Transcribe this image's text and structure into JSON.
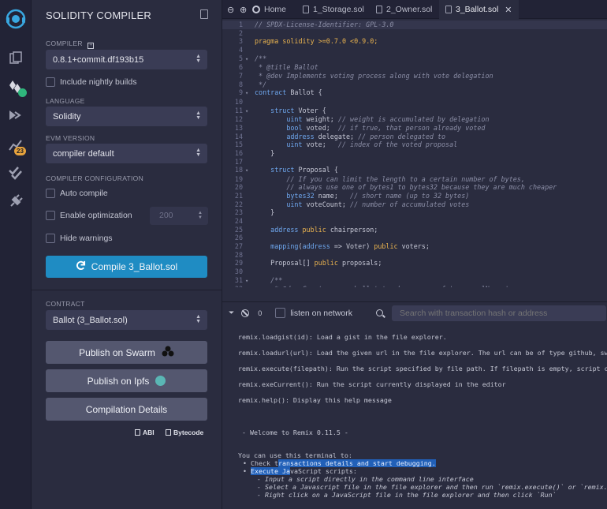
{
  "rail": {
    "icons": [
      "remix-logo-icon",
      "file-explorer-icon",
      "solidity-compiler-icon",
      "deploy-run-icon",
      "analysis-icon",
      "testing-icon",
      "plugin-manager-icon"
    ],
    "badge": "23"
  },
  "compiler": {
    "title": "SOLIDITY COMPILER",
    "compiler_label": "COMPILER",
    "compiler_version": "0.8.1+commit.df193b15",
    "include_nightly": "Include nightly builds",
    "language_label": "LANGUAGE",
    "language": "Solidity",
    "evm_label": "EVM VERSION",
    "evm": "compiler default",
    "config_label": "COMPILER CONFIGURATION",
    "auto_compile": "Auto compile",
    "enable_optimization": "Enable optimization",
    "runs": "200",
    "hide_warnings": "Hide warnings",
    "compile_button": "Compile 3_Ballot.sol",
    "contract_label": "CONTRACT",
    "contract": "Ballot (3_Ballot.sol)",
    "publish_swarm": "Publish on Swarm",
    "publish_ipfs": "Publish on Ipfs",
    "compilation_details": "Compilation Details",
    "abi": "ABI",
    "bytecode": "Bytecode",
    "accent": "#1f8cc3"
  },
  "tabs": {
    "home": "Home",
    "tab1": "1_Storage.sol",
    "tab2": "2_Owner.sol",
    "tab3": "3_Ballot.sol"
  },
  "editor": {
    "lines": [
      {
        "n": "1",
        "fold": "",
        "parts": [
          {
            "c": "cm",
            "t": "// SPDX-License-Identifier: GPL-3.0"
          }
        ]
      },
      {
        "n": "2",
        "fold": "",
        "parts": []
      },
      {
        "n": "3",
        "fold": "",
        "parts": [
          {
            "c": "pr",
            "t": "pragma solidity "
          },
          {
            "c": "pr",
            "t": ">=0.7.0 <0.9.0;"
          }
        ]
      },
      {
        "n": "4",
        "fold": "",
        "parts": []
      },
      {
        "n": "5",
        "fold": "▾",
        "parts": [
          {
            "c": "cm",
            "t": "/**"
          }
        ]
      },
      {
        "n": "6",
        "fold": "",
        "parts": [
          {
            "c": "cm",
            "t": " * @title Ballot"
          }
        ]
      },
      {
        "n": "7",
        "fold": "",
        "parts": [
          {
            "c": "cm",
            "t": " * @dev Implements voting process along with vote delegation"
          }
        ]
      },
      {
        "n": "8",
        "fold": "",
        "parts": [
          {
            "c": "cm",
            "t": " */"
          }
        ]
      },
      {
        "n": "9",
        "fold": "▾",
        "parts": [
          {
            "c": "kw",
            "t": "contract"
          },
          {
            "c": "tx",
            "t": " Ballot {"
          }
        ]
      },
      {
        "n": "10",
        "fold": "",
        "parts": []
      },
      {
        "n": "11",
        "fold": "▾",
        "parts": [
          {
            "c": "tx",
            "t": "    "
          },
          {
            "c": "kw",
            "t": "struct"
          },
          {
            "c": "tx",
            "t": " Voter {"
          }
        ]
      },
      {
        "n": "12",
        "fold": "",
        "parts": [
          {
            "c": "tx",
            "t": "        "
          },
          {
            "c": "kw",
            "t": "uint"
          },
          {
            "c": "tx",
            "t": " weight; "
          },
          {
            "c": "cm",
            "t": "// weight is accumulated by delegation"
          }
        ]
      },
      {
        "n": "13",
        "fold": "",
        "parts": [
          {
            "c": "tx",
            "t": "        "
          },
          {
            "c": "kw",
            "t": "bool"
          },
          {
            "c": "tx",
            "t": " voted;  "
          },
          {
            "c": "cm",
            "t": "// if true, that person already voted"
          }
        ]
      },
      {
        "n": "14",
        "fold": "",
        "parts": [
          {
            "c": "tx",
            "t": "        "
          },
          {
            "c": "kw",
            "t": "address"
          },
          {
            "c": "tx",
            "t": " delegate; "
          },
          {
            "c": "cm",
            "t": "// person delegated to"
          }
        ]
      },
      {
        "n": "15",
        "fold": "",
        "parts": [
          {
            "c": "tx",
            "t": "        "
          },
          {
            "c": "kw",
            "t": "uint"
          },
          {
            "c": "tx",
            "t": " vote;   "
          },
          {
            "c": "cm",
            "t": "// index of the voted proposal"
          }
        ]
      },
      {
        "n": "16",
        "fold": "",
        "parts": [
          {
            "c": "tx",
            "t": "    }"
          }
        ]
      },
      {
        "n": "17",
        "fold": "",
        "parts": []
      },
      {
        "n": "18",
        "fold": "▾",
        "parts": [
          {
            "c": "tx",
            "t": "    "
          },
          {
            "c": "kw",
            "t": "struct"
          },
          {
            "c": "tx",
            "t": " Proposal {"
          }
        ]
      },
      {
        "n": "19",
        "fold": "",
        "parts": [
          {
            "c": "cm",
            "t": "        // If you can limit the length to a certain number of bytes,"
          }
        ]
      },
      {
        "n": "20",
        "fold": "",
        "parts": [
          {
            "c": "cm",
            "t": "        // always use one of bytes1 to bytes32 because they are much cheaper"
          }
        ]
      },
      {
        "n": "21",
        "fold": "",
        "parts": [
          {
            "c": "tx",
            "t": "        "
          },
          {
            "c": "kw",
            "t": "bytes32"
          },
          {
            "c": "tx",
            "t": " name;   "
          },
          {
            "c": "cm",
            "t": "// short name (up to 32 bytes)"
          }
        ]
      },
      {
        "n": "22",
        "fold": "",
        "parts": [
          {
            "c": "tx",
            "t": "        "
          },
          {
            "c": "kw",
            "t": "uint"
          },
          {
            "c": "tx",
            "t": " voteCount; "
          },
          {
            "c": "cm",
            "t": "// number of accumulated votes"
          }
        ]
      },
      {
        "n": "23",
        "fold": "",
        "parts": [
          {
            "c": "tx",
            "t": "    }"
          }
        ]
      },
      {
        "n": "24",
        "fold": "",
        "parts": []
      },
      {
        "n": "25",
        "fold": "",
        "parts": [
          {
            "c": "tx",
            "t": "    "
          },
          {
            "c": "kw",
            "t": "address"
          },
          {
            "c": "tx",
            "t": " "
          },
          {
            "c": "pr",
            "t": "public"
          },
          {
            "c": "tx",
            "t": " chairperson;"
          }
        ]
      },
      {
        "n": "26",
        "fold": "",
        "parts": []
      },
      {
        "n": "27",
        "fold": "",
        "parts": [
          {
            "c": "tx",
            "t": "    "
          },
          {
            "c": "kw",
            "t": "mapping"
          },
          {
            "c": "tx",
            "t": "("
          },
          {
            "c": "kw",
            "t": "address"
          },
          {
            "c": "tx",
            "t": " => Voter) "
          },
          {
            "c": "pr",
            "t": "public"
          },
          {
            "c": "tx",
            "t": " voters;"
          }
        ]
      },
      {
        "n": "28",
        "fold": "",
        "parts": []
      },
      {
        "n": "29",
        "fold": "",
        "parts": [
          {
            "c": "tx",
            "t": "    Proposal[] "
          },
          {
            "c": "pr",
            "t": "public"
          },
          {
            "c": "tx",
            "t": " proposals;"
          }
        ]
      },
      {
        "n": "30",
        "fold": "",
        "parts": []
      },
      {
        "n": "31",
        "fold": "▾",
        "parts": [
          {
            "c": "cm",
            "t": "    /**"
          }
        ]
      },
      {
        "n": "32",
        "fold": "",
        "parts": [
          {
            "c": "cm",
            "t": "     * @dev Create a new ballot to choose one of 'proposalNames'."
          }
        ]
      }
    ]
  },
  "terminal": {
    "count": "0",
    "listen_label": "listen on network",
    "search_placeholder": "Search with transaction hash or address",
    "help_lines": [
      "remix.loadgist(id): Load a gist in the file explorer.",
      "remix.loadurl(url): Load the given url in the file explorer. The url can be of type github, swarm,",
      "remix.execute(filepath): Run the script specified by file path. If filepath is empty, script currently",
      "remix.exeCurrent(): Run the script currently displayed in the editor",
      "remix.help(): Display this help message"
    ],
    "welcome": " - Welcome to Remix 0.11.5 -",
    "use_for": "You can use this terminal to:",
    "bullet1_pre": "Check t",
    "bullet1_sel": "ransactions details and start debugging.",
    "bullet2_sel": "Execute Ja",
    "bullet2_post": "vaScript scripts:",
    "sub1": "- Input a script directly in the command line interface",
    "sub2": "- Select a Javascript file in the file explorer and then run `remix.execute()` or `remix.exeCurrent()`",
    "sub3": "- Right click on a JavaScript file in the file explorer and then click `Run`"
  }
}
